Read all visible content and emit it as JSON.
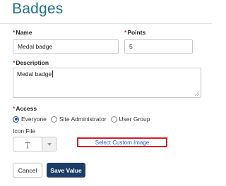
{
  "page": {
    "title": "Badges"
  },
  "form": {
    "name": {
      "label": "Name",
      "value": "Medal badge",
      "required_mark": "*"
    },
    "points": {
      "label": "Points",
      "value": "5",
      "required_mark": "*"
    },
    "description": {
      "label": "Description",
      "value": "Medal badge",
      "required_mark": "*"
    },
    "access": {
      "label": "Access",
      "required_mark": "*",
      "options": [
        "Everyone",
        "Site Administrator",
        "User Group"
      ],
      "selected": "Everyone"
    },
    "icon_file": {
      "label": "Icon File",
      "preview_icon": "pin-icon",
      "custom_image_link": "Select Custom Image"
    }
  },
  "buttons": {
    "cancel": "Cancel",
    "save": "Save Value"
  },
  "colors": {
    "title": "#1f6f8b",
    "required": "#d32f2f",
    "link": "#2a62b8",
    "highlight_border": "#d81b25",
    "primary_button": "#1b3d66",
    "radio_selected": "#1e4f9a"
  }
}
